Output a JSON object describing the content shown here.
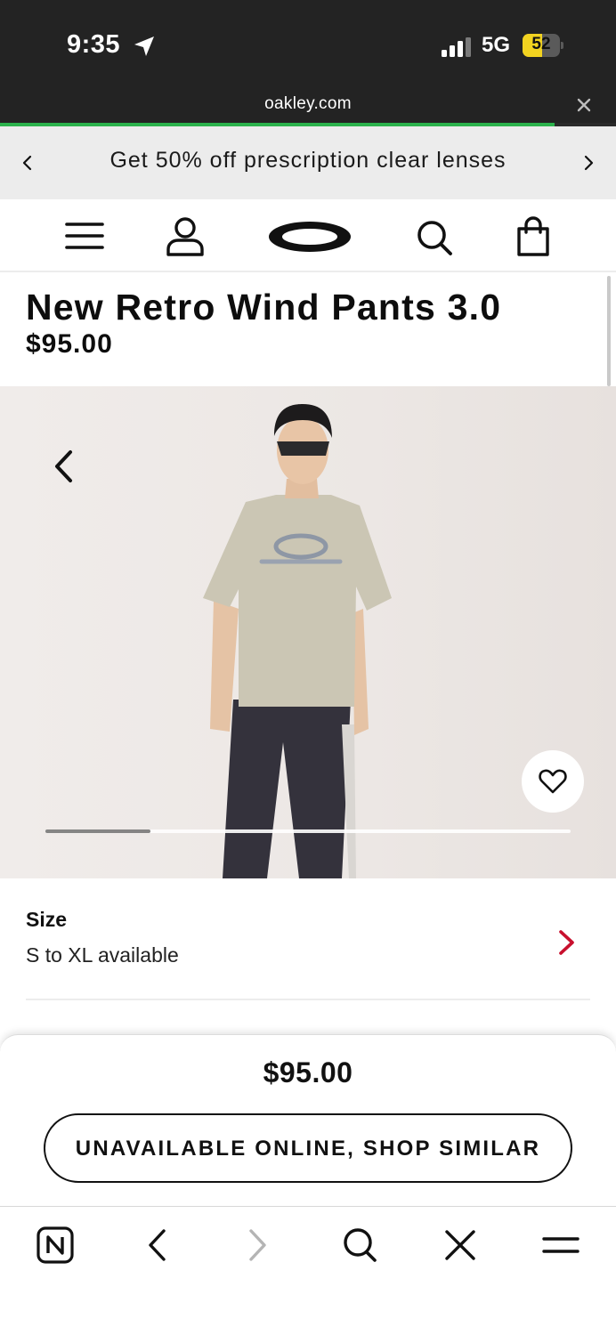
{
  "status_bar": {
    "time": "9:35",
    "network": "5G",
    "battery": "52",
    "battery_level": 0.52
  },
  "browser": {
    "url": "oakley.com",
    "load_progress": 0.9,
    "progress_color": "#2bb24c"
  },
  "promo": {
    "text": "Get 50% off prescription clear lenses"
  },
  "nav": {
    "icons": [
      "menu-icon",
      "account-icon",
      "oakley-logo",
      "search-icon",
      "shopping-bag-icon"
    ]
  },
  "product": {
    "title": "New Retro Wind Pants 3.0",
    "price": "$95.00"
  },
  "gallery": {
    "image_index_fraction": 0.2,
    "wishlist_icon": "heart-icon"
  },
  "size": {
    "label": "Size",
    "availability": "S to XL available",
    "chevron_color": "#c8102e"
  },
  "purchase": {
    "price": "$95.00",
    "button_label": "UNAVAILABLE ONLINE, SHOP SIMILAR"
  },
  "toolbar": {
    "icons": [
      "newsletter-n-icon",
      "back-icon",
      "forward-icon",
      "search-icon",
      "close-icon",
      "menu-icon"
    ]
  }
}
